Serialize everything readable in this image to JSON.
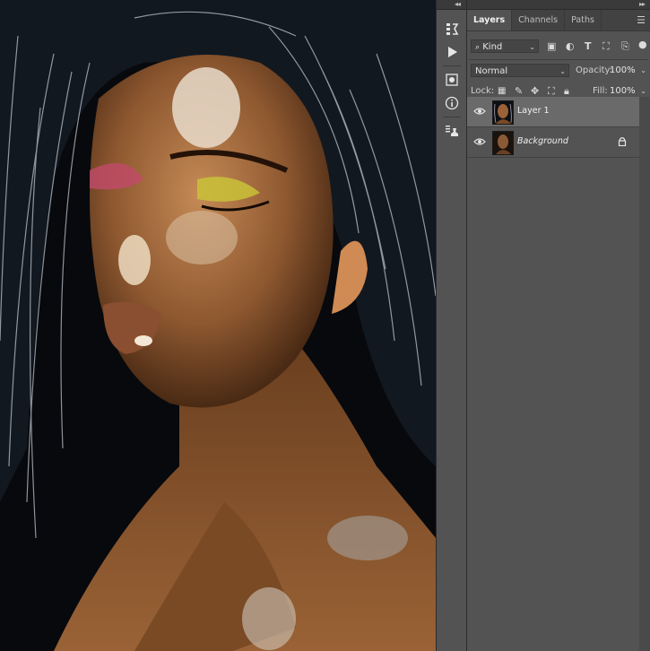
{
  "panel": {
    "tabs": [
      {
        "label": "Layers"
      },
      {
        "label": "Channels"
      },
      {
        "label": "Paths"
      }
    ],
    "filter": {
      "kind": "Kind"
    },
    "blend": {
      "mode": "Normal",
      "opacity_label": "Opacity:",
      "opacity": "100%"
    },
    "lock": {
      "label": "Lock:",
      "fill_label": "Fill:",
      "fill": "100%"
    },
    "layers": [
      {
        "name": "Layer 1",
        "selected": true
      },
      {
        "name": "Background",
        "locked": true
      }
    ]
  },
  "colors": {
    "panel_bg": "#535353",
    "tab_bar": "#424242",
    "selected_layer": "#6a6a6a",
    "canvas_bg": "#0a0c10"
  },
  "icons": [
    "history-icon",
    "play-action-icon",
    "adjustments-icon",
    "info-icon",
    "clone-source-icon",
    "panel-menu-icon",
    "search-icon",
    "eye-icon",
    "lock-icon"
  ]
}
